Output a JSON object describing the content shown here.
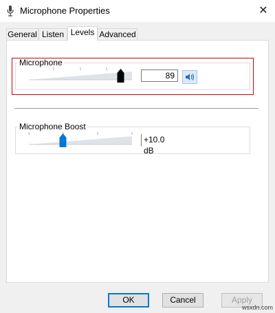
{
  "window": {
    "title": "Microphone Properties",
    "close_glyph": "✕"
  },
  "tabs": [
    {
      "label": "General",
      "active": false
    },
    {
      "label": "Listen",
      "active": false
    },
    {
      "label": "Levels",
      "active": true
    },
    {
      "label": "Advanced",
      "active": false
    }
  ],
  "microphone": {
    "group_label": "Microphone",
    "value_text": "89",
    "level_fraction": 0.89,
    "speaker_icon": "speaker-icon"
  },
  "boost": {
    "group_label": "Microphone Boost",
    "value_text": "+10.0 dB",
    "level_fraction": 0.33
  },
  "buttons": {
    "ok": "OK",
    "cancel": "Cancel",
    "apply": "Apply"
  },
  "watermark": "wsxdn.com",
  "colors": {
    "highlight": "#cc0000",
    "accent": "#0078d7",
    "thumb_mic": "#000000",
    "thumb_boost": "#0078d7"
  }
}
